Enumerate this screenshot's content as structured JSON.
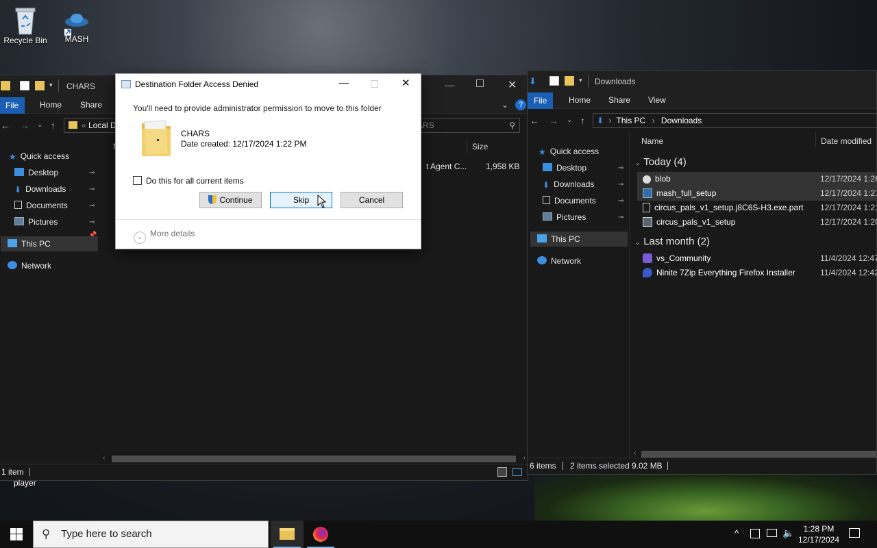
{
  "desktop": {
    "icons": [
      {
        "label": "Recycle Bin"
      },
      {
        "label": "MASH"
      }
    ],
    "partial_label": "player"
  },
  "left_window": {
    "title": "CHARS",
    "tabs": {
      "file": "File",
      "home": "Home",
      "share": "Share"
    },
    "address": "Local D",
    "search_placeholder": "Search CHARS",
    "search_visible": "ARS",
    "nav": {
      "quick_access": "Quick access",
      "desktop": "Desktop",
      "downloads": "Downloads",
      "documents": "Documents",
      "pictures": "Pictures",
      "this_pc": "This PC",
      "network": "Network"
    },
    "columns": {
      "name": "N",
      "size": "Size"
    },
    "row": {
      "name": "t Agent C...",
      "size": "1,958 KB"
    },
    "status": "1 item"
  },
  "right_window": {
    "title": "Downloads",
    "tabs": {
      "file": "File",
      "home": "Home",
      "share": "Share",
      "view": "View"
    },
    "breadcrumb": {
      "root": "This PC",
      "current": "Downloads"
    },
    "nav": {
      "quick_access": "Quick access",
      "desktop": "Desktop",
      "downloads": "Downloads",
      "documents": "Documents",
      "pictures": "Pictures",
      "this_pc": "This PC",
      "network": "Network"
    },
    "columns": {
      "name": "Name",
      "date": "Date modified"
    },
    "groups": [
      {
        "label": "Today (4)",
        "files": [
          {
            "name": "blob",
            "date": "12/17/2024 1:26",
            "selected": true
          },
          {
            "name": "mash_full_setup",
            "date": "12/17/2024 1:21",
            "selected": true
          },
          {
            "name": "circus_pals_v1_setup.j8C6S-H3.exe.part",
            "date": "12/17/2024 1:21",
            "selected": false
          },
          {
            "name": "circus_pals_v1_setup",
            "date": "12/17/2024 1:20",
            "selected": false
          }
        ]
      },
      {
        "label": "Last month (2)",
        "files": [
          {
            "name": "vs_Community",
            "date": "11/4/2024 12:47",
            "selected": false
          },
          {
            "name": "Ninite 7Zip Everything Firefox Installer",
            "date": "11/4/2024 12:42",
            "selected": false
          }
        ]
      }
    ],
    "status": {
      "items": "6 items",
      "selected": "2 items selected",
      "size": "9.02 MB"
    }
  },
  "dialog": {
    "title": "Destination Folder Access Denied",
    "message": "You'll need to provide administrator permission to move to this folder",
    "folder_name": "CHARS",
    "date_created": "Date created: 12/17/2024 1:22 PM",
    "checkbox_label": "Do this for all current items",
    "buttons": {
      "continue": "Continue",
      "skip": "Skip",
      "cancel": "Cancel"
    },
    "more_details": "More details"
  },
  "taskbar": {
    "search_placeholder": "Type here to search",
    "time": "1:28 PM",
    "date": "12/17/2024"
  },
  "colors": {
    "accent": "#1a5fb4",
    "selection": "#333333"
  }
}
